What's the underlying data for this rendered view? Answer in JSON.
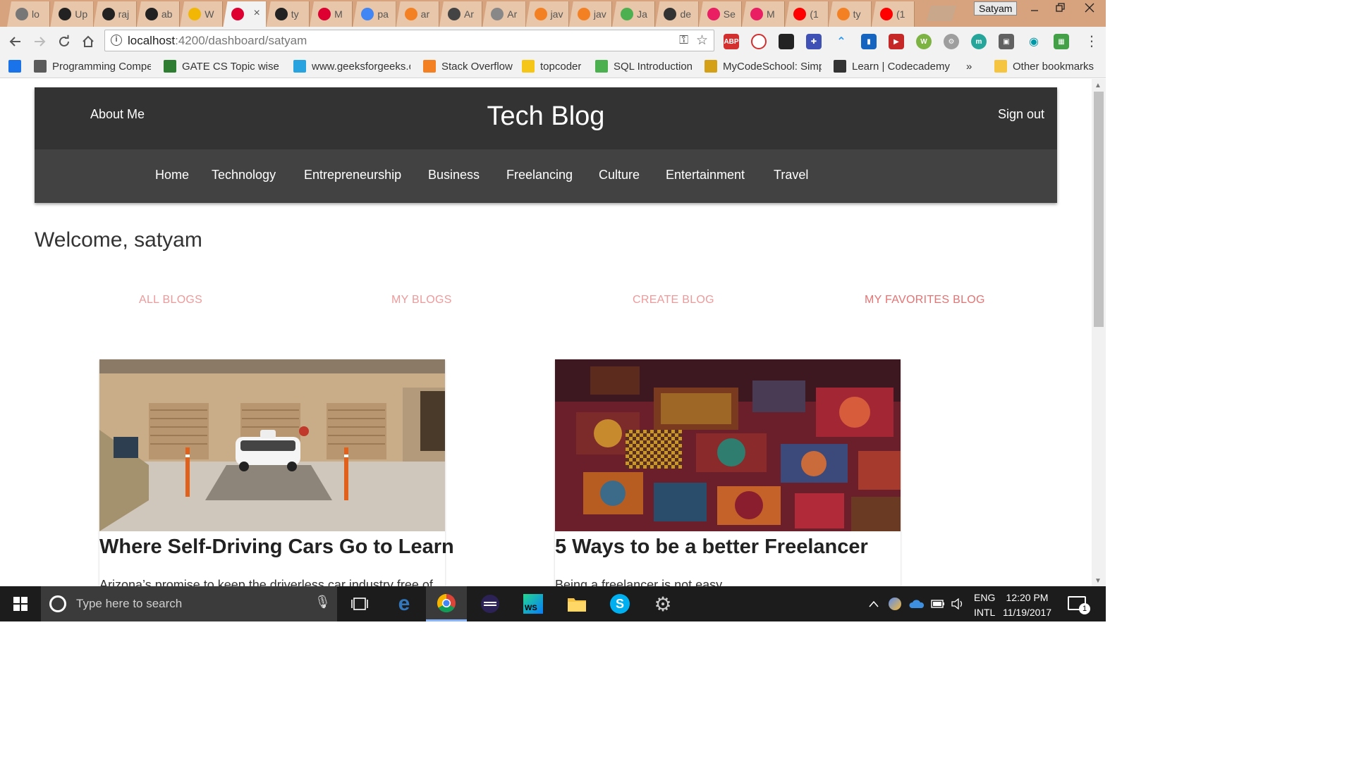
{
  "browser": {
    "tabs": [
      {
        "title": "lo",
        "icon": "smiley-icon",
        "color": "#777777"
      },
      {
        "title": "Up",
        "icon": "github-icon",
        "color": "#222222"
      },
      {
        "title": "raj",
        "icon": "github-icon",
        "color": "#222222"
      },
      {
        "title": "ab",
        "icon": "github-icon",
        "color": "#222222"
      },
      {
        "title": "W",
        "icon": "ih-icon",
        "color": "#f2b705"
      },
      {
        "title": "",
        "icon": "angular-icon",
        "color": "#dd0031",
        "active": true
      },
      {
        "title": "ty",
        "icon": "github-icon",
        "color": "#222222"
      },
      {
        "title": "M",
        "icon": "angular-icon",
        "color": "#dd0031"
      },
      {
        "title": "pa",
        "icon": "google-icon",
        "color": "#4285f4"
      },
      {
        "title": "ar",
        "icon": "stackoverflow-icon",
        "color": "#f48024"
      },
      {
        "title": "Ar",
        "icon": "robot-icon",
        "color": "#444444"
      },
      {
        "title": "Ar",
        "icon": "list-icon",
        "color": "#888888"
      },
      {
        "title": "jav",
        "icon": "stackoverflow-icon",
        "color": "#f48024"
      },
      {
        "title": "jav",
        "icon": "stackoverflow-icon",
        "color": "#f48024"
      },
      {
        "title": "Ja",
        "icon": "w3-icon",
        "color": "#4caf50"
      },
      {
        "title": "de",
        "icon": "chat-icon",
        "color": "#333333"
      },
      {
        "title": "Se",
        "icon": "play-icon",
        "color": "#e91e63"
      },
      {
        "title": "M",
        "icon": "play-icon",
        "color": "#e91e63"
      },
      {
        "title": "(1",
        "icon": "youtube-icon",
        "color": "#ff0000"
      },
      {
        "title": "ty",
        "icon": "stackoverflow-icon",
        "color": "#f48024"
      },
      {
        "title": "(1",
        "icon": "youtube-icon",
        "color": "#ff0000"
      }
    ],
    "profile_name": "Satyam",
    "url_host": "localhost",
    "url_path": ":4200/dashboard/satyam",
    "bookmarks": [
      {
        "label": "",
        "color": "#1a73e8",
        "icon": "drive-icon"
      },
      {
        "label": "Programming Compe",
        "color": "#5b5b5b",
        "icon": "cc-icon"
      },
      {
        "label": "GATE CS Topic wise p",
        "color": "#2e7d32",
        "icon": "gfg-icon"
      },
      {
        "label": "www.geeksforgeeks.c",
        "color": "#29a3e0",
        "icon": "t-icon"
      },
      {
        "label": "Stack Overflow",
        "color": "#f48024",
        "icon": "stackoverflow-icon"
      },
      {
        "label": "topcoder",
        "color": "#f5c518",
        "icon": "topcoder-icon"
      },
      {
        "label": "SQL Introduction",
        "color": "#4caf50",
        "icon": "w3-icon"
      },
      {
        "label": "MyCodeSchool: Simp",
        "color": "#d4a017",
        "icon": "code-icon"
      },
      {
        "label": "Learn | Codecademy",
        "color": "#333333",
        "icon": "codecademy-icon"
      },
      {
        "label": "»",
        "color": "",
        "icon": "more-icon"
      },
      {
        "label": "Other bookmarks",
        "color": "#f5c542",
        "icon": "folder-icon"
      }
    ]
  },
  "site": {
    "about_label": "About Me",
    "brand": "Tech Blog",
    "signout_label": "Sign out",
    "categories": [
      "Home",
      "Technology",
      "Entrepreneurship",
      "Business",
      "Freelancing",
      "Culture",
      "Entertainment",
      "Travel"
    ],
    "welcome": "Welcome, satyam",
    "dashboard_tabs": [
      "ALL BLOGS",
      "MY BLOGS",
      "CREATE BLOG",
      "MY FAVORITES BLOG"
    ],
    "active_tab": "MY FAVORITES BLOG",
    "cards": [
      {
        "title": "Where Self-Driving Cars Go to Learn",
        "excerpt": "Arizona’s promise to keep the driverless car industry free of",
        "image": "self-driving-car-photo"
      },
      {
        "title": "5 Ways to be a better Freelancer",
        "excerpt": "Being a freelancer is not easy",
        "image": "painted-boxes-photo"
      }
    ],
    "colors": {
      "header_top": "#333333",
      "header_nav": "#424242",
      "tab_text": "#ef9a9a"
    }
  },
  "taskbar": {
    "search_placeholder": "Type here to search",
    "lang_top": "ENG",
    "lang_bottom": "INTL",
    "time": "12:20 PM",
    "date": "11/19/2017",
    "notification_count": "1"
  }
}
